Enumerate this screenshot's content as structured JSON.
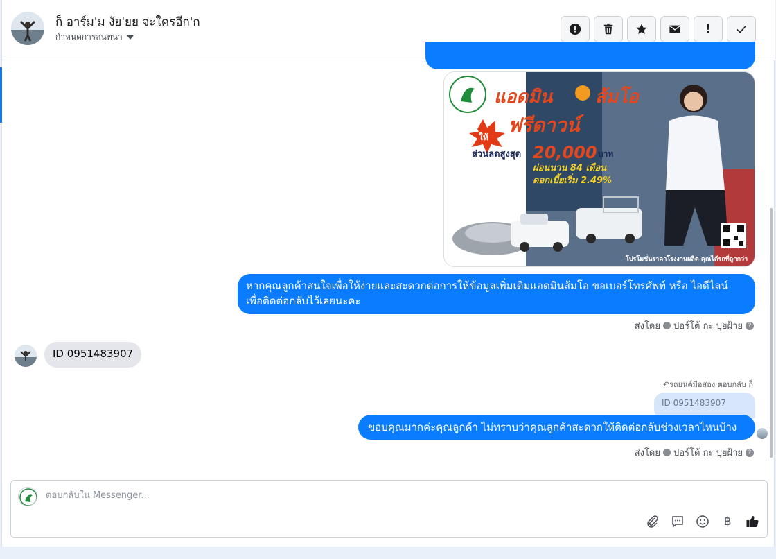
{
  "header": {
    "contact_name": "ก็ อาร์ม'ม งัย'ยย จะใครอีก'ก",
    "assign_label": "กำหนดการสนทนา"
  },
  "toolbar": {
    "buttons": [
      {
        "name": "report",
        "icon": "alert-circle-icon"
      },
      {
        "name": "delete",
        "icon": "trash-icon"
      },
      {
        "name": "star",
        "icon": "star-icon"
      },
      {
        "name": "mark-unread",
        "icon": "envelope-icon"
      },
      {
        "name": "follow-up",
        "icon": "exclamation-icon",
        "glyph": "!"
      },
      {
        "name": "done",
        "icon": "check-icon"
      }
    ]
  },
  "promo": {
    "title_left": "แอดมิน",
    "title_right": "ส้มโอ",
    "badge": "ให้",
    "headline": "ฟรีดาวน์",
    "line1_prefix": "ส่วนลดสูงสุด",
    "line1_value": "20,000",
    "line1_unit": "บาท",
    "line2": "ผ่อนนาน 84 เดือน",
    "line3": "ดอกเบี้ยเริ่ม 2.49%",
    "footer": "โปรโมชั่นราคาโรงงานผลิต คุณได้รถที่ถูกกว่า"
  },
  "messages": {
    "outgoing_1": "หากคุณลูกค้าสนใจเพื่อให้ง่ายและสะดวกต่อการให้ข้อมูลเพิ่มเติมแอดมินส้มโอ ขอเบอร์โทรศัพท์ หรือ ไอดีไลน์ เพื่อติดต่อกลับไว้เลยนะคะ",
    "sent_by_label": "ส่งโดย",
    "sent_by_name": "ปอร์โต้ กะ ปุยฝ้าย",
    "incoming_1": "ID 0951483907",
    "reply_note": "รถยนต์มือสอง ตอบกลับ ก็",
    "quoted": "ID 0951483907",
    "outgoing_2": "ขอบคุณมากค่ะคุณลูกค้า ไม่ทราบว่าคุณลูกค้าสะดวกให้ติดต่อกลับช่วงเวลาไหนบ้างคะ"
  },
  "composer": {
    "placeholder": "ตอบกลับใน Messenger...",
    "currency_glyph": "฿"
  },
  "colors": {
    "accent": "#0a7cff",
    "incoming_bg": "#e4e6eb",
    "quoted_bg": "#d8e6fb"
  }
}
